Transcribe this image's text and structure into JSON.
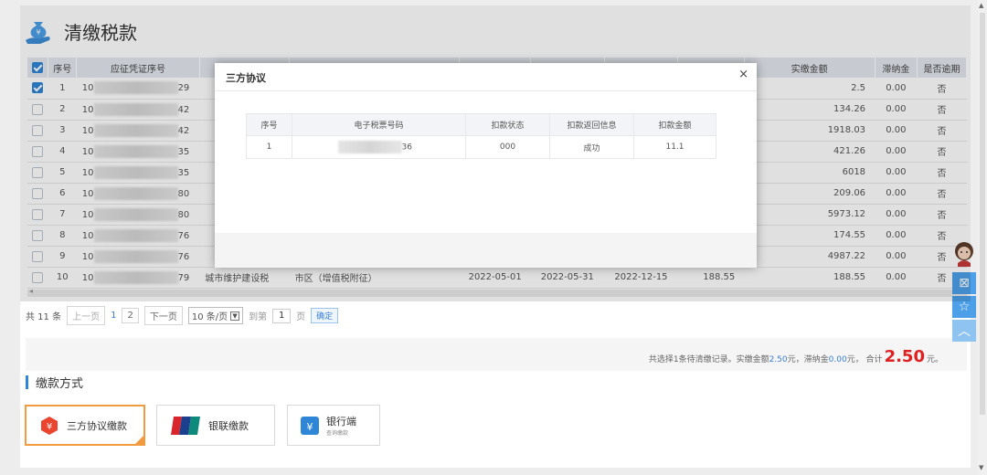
{
  "header": {
    "title": "清缴税款",
    "icon": "money-bag-icon"
  },
  "table": {
    "columns": [
      "序号",
      "应征凭证序号",
      "实缴金额",
      "滞纳金",
      "是否逾期"
    ],
    "rows": [
      {
        "no": "1",
        "voucher_prefix": "10",
        "voucher_suffix": "29",
        "amount": "2.5",
        "late_fee": "0.00",
        "overdue": "否",
        "checked": true
      },
      {
        "no": "2",
        "voucher_prefix": "10",
        "voucher_suffix": "42",
        "amount": "134.26",
        "late_fee": "0.00",
        "overdue": "否",
        "checked": false
      },
      {
        "no": "3",
        "voucher_prefix": "10",
        "voucher_suffix": "42",
        "amount": "1918.03",
        "late_fee": "0.00",
        "overdue": "否",
        "checked": false
      },
      {
        "no": "4",
        "voucher_prefix": "10",
        "voucher_suffix": "35",
        "amount": "421.26",
        "late_fee": "0.00",
        "overdue": "否",
        "checked": false
      },
      {
        "no": "5",
        "voucher_prefix": "10",
        "voucher_suffix": "35",
        "amount": "6018",
        "late_fee": "0.00",
        "overdue": "否",
        "checked": false
      },
      {
        "no": "6",
        "voucher_prefix": "10",
        "voucher_suffix": "80",
        "amount": "209.06",
        "late_fee": "0.00",
        "overdue": "否",
        "checked": false
      },
      {
        "no": "7",
        "voucher_prefix": "10",
        "voucher_suffix": "80",
        "amount": "5973.12",
        "late_fee": "0.00",
        "overdue": "否",
        "checked": false
      },
      {
        "no": "8",
        "voucher_prefix": "10",
        "voucher_suffix": "76",
        "amount": "174.55",
        "late_fee": "0.00",
        "overdue": "否",
        "checked": false
      },
      {
        "no": "9",
        "voucher_prefix": "10",
        "voucher_suffix": "76",
        "amount": "4987.22",
        "late_fee": "0.00",
        "overdue": "否",
        "checked": false
      },
      {
        "no": "10",
        "voucher_prefix": "10",
        "voucher_suffix": "79",
        "tax_type": "城市维护建设税",
        "tax_item": "市区（增值税附征）",
        "start": "2022-05-01",
        "end": "2022-05-31",
        "deadline": "2022-12-15",
        "payable": "188.55",
        "amount": "188.55",
        "late_fee": "0.00",
        "overdue": "否",
        "checked": false
      }
    ]
  },
  "pagination": {
    "total": "共 11 条",
    "prev": "上一页",
    "page1": "1",
    "page2": "2",
    "next": "下一页",
    "page_size": "10 条/页",
    "goto_label": "到第",
    "goto_value": "1",
    "page_unit": "页",
    "confirm": "确定"
  },
  "summary": {
    "text1": "共选择1条待清缴记录。实缴金额",
    "amount": "2.50",
    "text2": " 元，滞纳金 ",
    "late": "0.00",
    "text3": "元， 合计",
    "total": "2.50",
    "text4": "元。"
  },
  "pay": {
    "heading": "缴款方式",
    "methods": [
      {
        "label": "三方协议缴款",
        "icon": "tripartite-agreement-icon"
      },
      {
        "label": "银联缴款",
        "icon": "unionpay-icon"
      },
      {
        "label": "银行端",
        "sub": "查询缴款",
        "icon": "bank-icon"
      }
    ]
  },
  "modal": {
    "title": "三方协议",
    "close": "×",
    "columns": [
      "序号",
      "电子税票号码",
      "扣款状态",
      "扣款返回信息",
      "扣款金额"
    ],
    "row": {
      "no": "1",
      "ticket_suffix": "36",
      "status": "000",
      "message": "成功",
      "amount": "11.1"
    }
  },
  "colors": {
    "accent": "#2f86d6",
    "active_border": "#f19a3e",
    "total_red": "#e02020"
  }
}
